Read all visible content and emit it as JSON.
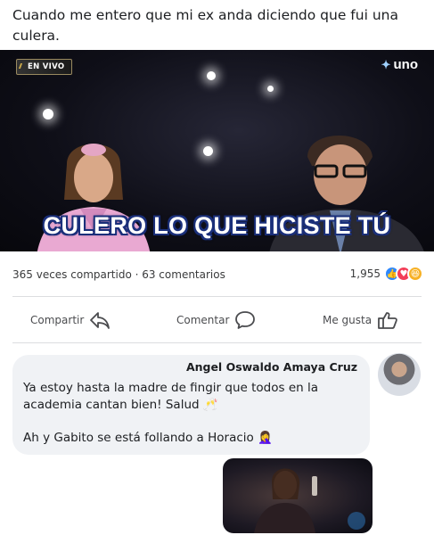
{
  "post": {
    "caption": "Cuando me entero que mi ex anda diciendo que fui una culera."
  },
  "video": {
    "live_label": "EN VIVO",
    "channel_logo": "uno",
    "subtitle": "CULERO LO QUE HICISTE TÚ"
  },
  "stats": {
    "shares_comments": "365 veces compartido · 63 comentarios",
    "reaction_count": "1,955",
    "reactions": [
      "like-icon",
      "love-icon",
      "haha-icon"
    ]
  },
  "actions": {
    "share_label": "Compartir",
    "comment_label": "Comentar",
    "like_label": "Me gusta"
  },
  "comment": {
    "author": "Angel Oswaldo Amaya Cruz",
    "line1": "Ya estoy hasta la madre de fingir que todos en la academia cantan  bien! Salud 🥂",
    "line2": "Ah y Gabito se está follando a Horacio 🤦‍♀️"
  },
  "colors": {
    "like_blue": "#2d88ff",
    "love_red": "#f33e58",
    "haha_yellow": "#f7b125",
    "subtitle_outline": "#1a2f7a",
    "comment_bg": "#f0f2f5"
  }
}
